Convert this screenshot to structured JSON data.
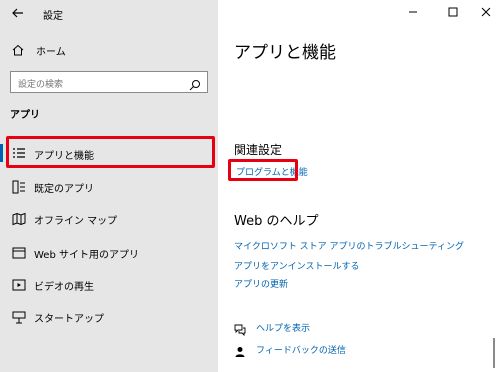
{
  "window": {
    "title": "設定",
    "controls": [
      "minimize-icon",
      "maximize-icon",
      "close-icon"
    ]
  },
  "sidebar": {
    "home_label": "ホーム",
    "search_placeholder": "設定の検索",
    "section_label": "アプリ",
    "items": [
      {
        "label": "アプリと機能",
        "icon": "apps-features-icon",
        "active": true
      },
      {
        "label": "既定のアプリ",
        "icon": "default-apps-icon",
        "active": false
      },
      {
        "label": "オフライン マップ",
        "icon": "offline-maps-icon",
        "active": false
      },
      {
        "label": "Web サイト用のアプリ",
        "icon": "apps-for-websites-icon",
        "active": false
      },
      {
        "label": "ビデオの再生",
        "icon": "video-playback-icon",
        "active": false
      },
      {
        "label": "スタートアップ",
        "icon": "startup-icon",
        "active": false
      }
    ]
  },
  "main": {
    "title": "アプリと機能",
    "related_heading": "関連設定",
    "related_link": "プログラムと機能",
    "web_heading": "Web のヘルプ",
    "web_links": [
      "マイクロソフト ストア アプリのトラブルシューティング",
      "アプリをアンインストールする",
      "アプリの更新"
    ],
    "help_label": "ヘルプを表示",
    "feedback_label": "フィードバックの送信"
  },
  "colors": {
    "accent": "#0063b1",
    "highlight": "#e60012",
    "sidebar_bg": "#e6e6e6"
  }
}
